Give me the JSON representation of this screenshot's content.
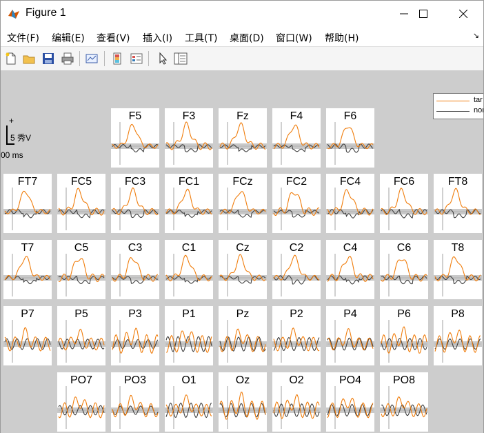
{
  "window": {
    "title": "Figure 1"
  },
  "menu": [
    {
      "label": "文件(F)"
    },
    {
      "label": "编辑(E)"
    },
    {
      "label": "查看(V)"
    },
    {
      "label": "插入(I)"
    },
    {
      "label": "工具(T)"
    },
    {
      "label": "桌面(D)"
    },
    {
      "label": "窗口(W)"
    },
    {
      "label": "帮助(H)"
    }
  ],
  "toolbar": {
    "icons": [
      "new-figure-icon",
      "open-file-icon",
      "save-icon",
      "print-icon",
      "link-plot-icon",
      "colorbar-icon",
      "legend-icon",
      "pointer-icon",
      "property-inspector-icon"
    ]
  },
  "scale": {
    "plus": "+",
    "amplitude": "5 秀V",
    "time": "00 ms"
  },
  "legend": {
    "entries": [
      {
        "name": "tar",
        "color": "#F07D0C"
      },
      {
        "name": "non",
        "color": "#404040"
      }
    ]
  },
  "colors": {
    "target": "#F07D0C",
    "nontarget": "#404040",
    "background": "#CDCDCD"
  },
  "rows": [
    [
      "F5",
      "F3",
      "Fz",
      "F4",
      "F6"
    ],
    [
      "FT7",
      "FC5",
      "FC3",
      "FC1",
      "FCz",
      "FC2",
      "FC4",
      "FC6",
      "FT8"
    ],
    [
      "T7",
      "C5",
      "C3",
      "C1",
      "Cz",
      "C2",
      "C4",
      "C6",
      "T8"
    ],
    [
      "P7",
      "P5",
      "P3",
      "P1",
      "Pz",
      "P2",
      "P4",
      "P6",
      "P8"
    ],
    [
      "PO7",
      "PO3",
      "O1",
      "Oz",
      "O2",
      "PO4",
      "PO8"
    ]
  ]
}
